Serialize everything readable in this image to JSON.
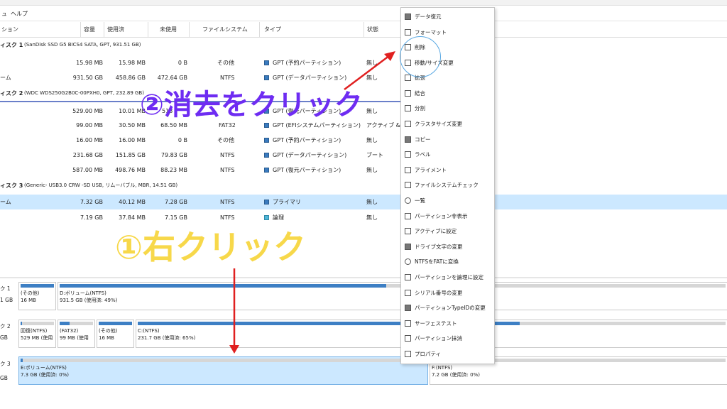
{
  "menu": {
    "left": "ュ",
    "help": "ヘルプ"
  },
  "columns": [
    "ション",
    "容量",
    "使用済",
    "未使用",
    "ファイルシステム",
    "タイプ",
    "状態"
  ],
  "disk_rows": [
    {
      "label": "ィスク 1",
      "desc": "(SanDisk SSD G5 BICS4 SATA, GPT, 931.51 GB)"
    },
    {
      "label": "ィスク 2",
      "desc": "(WDC WDS250G2B0C-00PXH0, GPT, 232.89 GB)"
    },
    {
      "label": "ィスク 3",
      "desc": "(Generic- USB3.0 CRW -SD USB, リムーバブル, MBR, 14.51 GB)"
    }
  ],
  "partition_rows": [
    {
      "name": "",
      "cap": "15.98 MB",
      "used": "15.98 MB",
      "free": "0 B",
      "fs": "その他",
      "type": "GPT (予約パーティション)",
      "status": "無し"
    },
    {
      "name": "ーム",
      "cap": "931.50 GB",
      "used": "458.86 GB",
      "free": "472.64 GB",
      "fs": "NTFS",
      "type": "GPT (データパーティション)",
      "status": "無し"
    },
    {
      "name": "",
      "cap": "529.00 MB",
      "used": "10.01 MB",
      "free": "518",
      "fs": "",
      "type": "GPT (復元パーティション)",
      "status": "無し"
    },
    {
      "name": "",
      "cap": "99.00 MB",
      "used": "30.50 MB",
      "free": "68.50 MB",
      "fs": "FAT32",
      "type": "GPT (EFIシステムパーティション)",
      "status": "アクティブ & シ"
    },
    {
      "name": "",
      "cap": "16.00 MB",
      "used": "16.00 MB",
      "free": "0 B",
      "fs": "その他",
      "type": "GPT (予約パーティション)",
      "status": "無し"
    },
    {
      "name": "",
      "cap": "231.68 GB",
      "used": "151.85 GB",
      "free": "79.83 GB",
      "fs": "NTFS",
      "type": "GPT (データパーティション)",
      "status": "ブート"
    },
    {
      "name": "",
      "cap": "587.00 MB",
      "used": "498.76 MB",
      "free": "88.23 MB",
      "fs": "NTFS",
      "type": "GPT (復元パーティション)",
      "status": "無し"
    },
    {
      "name": "ーム",
      "cap": "7.32 GB",
      "used": "40.12 MB",
      "free": "7.28 GB",
      "fs": "NTFS",
      "type": "プライマリ",
      "status": "無し"
    },
    {
      "name": "",
      "cap": "7.19 GB",
      "used": "37.84 MB",
      "free": "7.15 GB",
      "fs": "NTFS",
      "type": "論理",
      "status": "無し"
    }
  ],
  "diskmap": {
    "d1": {
      "l1": "ク 1",
      "l2": "1 GB"
    },
    "d2": {
      "l1": "ク 2",
      "l2": "GB"
    },
    "d3": {
      "l1": "ク 3",
      "l2": "GB"
    },
    "p1a": {
      "l1": "(その他)",
      "l2": "16 MB",
      "fill": 1.0
    },
    "p1b": {
      "l1": "D:ボリューム(NTFS)",
      "l2": "931.5 GB (使用済: 49%)",
      "fill": 0.49
    },
    "p2a": {
      "l1": "回復(NTFS)",
      "l2": "529 MB (使用",
      "fill": 0.05
    },
    "p2b": {
      "l1": "(FAT32)",
      "l2": "99 MB (使用",
      "fill": 0.3
    },
    "p2c": {
      "l1": "(その他)",
      "l2": "16 MB",
      "fill": 1.0
    },
    "p2d": {
      "l1": "C:(NTFS)",
      "l2": "231.7 GB (使用済: 65%)",
      "fill": 0.65
    },
    "p3a": {
      "l1": "E:ボリューム(NTFS)",
      "l2": "7.3 GB (使用済: 0%)",
      "fill": 0.005
    },
    "p3b": {
      "l1": "F:(NTFS)",
      "l2": "7.2 GB (使用済: 0%)",
      "fill": 0.005
    }
  },
  "context_menu": [
    "データ復元",
    "フォーマット",
    "削除",
    "移動/サイズ変更",
    "拡張",
    "結合",
    "分割",
    "クラスタサイズ変更",
    "コピー",
    "ラベル",
    "アライメント",
    "ファイルシステムチェック",
    "一覧",
    "パーティション非表示",
    "アクティブに設定",
    "ドライブ文字の変更",
    "NTFSをFATに変換",
    "パーティションを論理に設定",
    "シリアル番号の変更",
    "パーティションTypeIDの変更",
    "サーフェステスト",
    "パーティション抹消",
    "プロパティ"
  ],
  "annotations": {
    "step2": "②消去をクリック",
    "step1": "①右クリック",
    "step2_color": "#6e2cf2",
    "step1_color": "#f7d84a",
    "arrow_color": "#e02020"
  }
}
